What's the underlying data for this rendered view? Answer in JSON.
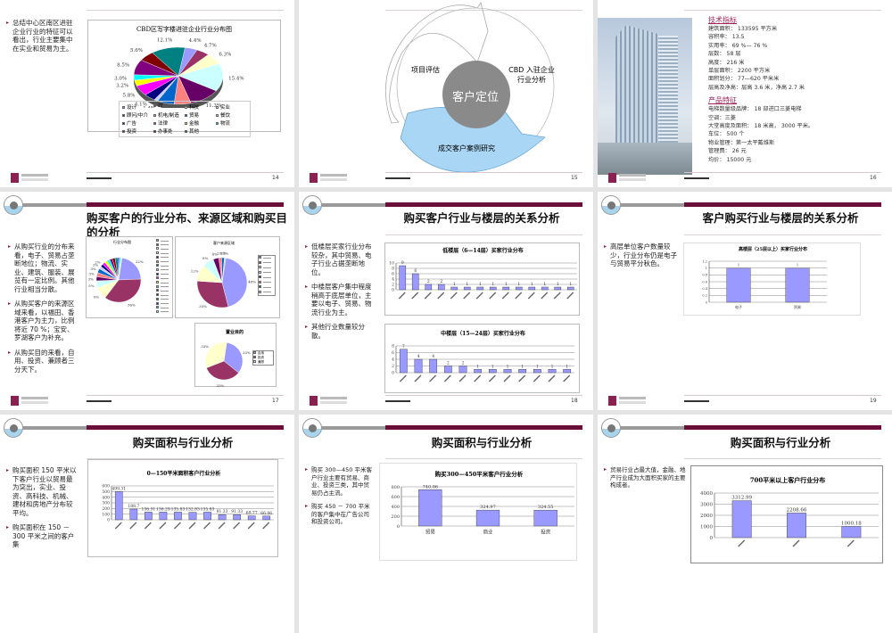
{
  "footer": {
    "pages": [
      "14",
      "15",
      "16",
      "17",
      "18",
      "19"
    ]
  },
  "s14": {
    "bullet": "总结中心区南区进驻企业行业的特征可以看出，行业主要集中在实业和贸易为主。"
  },
  "s15": {
    "center": "客户定位",
    "left": "项目评估",
    "right": "CBD 入驻企业行业分析",
    "bottom": "成交客户案例研究"
  },
  "s16": {
    "h1": "技术指标",
    "tech": [
      "建筑面积： 133595 平方米",
      "容积率： 13.5",
      "实用率： 69 %— 76 %",
      "层数： 58 层",
      "高度： 216 米",
      "单层面积： 2200 平方米",
      "面积划分： 77—620 平米米",
      "层高及净高：层高 3.6 米，净高 2.7 米"
    ],
    "h2": "产品特征",
    "prod": [
      "电梯数量级品牌： 18 部进口三菱电梯",
      "空调：三菱",
      "大堂高度及面积： 18 米高， 3000 平米。",
      "车位： 500 个",
      "物业管理：第一太平戴维斯",
      "管理费： 26 元",
      "均价： 15000 元"
    ]
  },
  "s17": {
    "title": "购买客户的行业分布、来源区域和购买目的分析",
    "bullets": [
      "从购买行业的分布来看，电子、贸易占垄断地位；物流、实业、建筑、服装、展览有一定比例。其他行业相当分散。",
      "从购买客户的来源区域来看，以福田、香港客户为主力，比例将近 70 %；宝安、罗湖客户为补充。",
      "从购买目的来看，自用、投资、兼顾者三分天下。"
    ]
  },
  "s18": {
    "title": "购买客户行业与楼层的关系分析",
    "bullets": [
      "低楼层买家行业分布较杂，其中贸易、电子行业占据垄断地位。",
      "中楼层客户集中程度稍高于底层单位，主要以电子、贸易、物流行业为主。",
      "其他行业数量较分散。"
    ]
  },
  "s19": {
    "title": "客户购买行业与楼层的关系分析",
    "bullets": [
      "高层单位客户数量较少，行业分布仍是电子与贸易平分秋色。"
    ]
  },
  "s20": {
    "title": "购买面积与行业分析",
    "bullets": [
      "购买面积 150 平米以下客户行业以贸易最为突出，实业、投资、高科技、机械、建材和房地产分布较平均。",
      "购买面积在 150 － 300 平米之间的客户集"
    ]
  },
  "s21": {
    "title": "购买面积与行业分析",
    "bullets": [
      "购买 300—450 平米客户行业主要有贸易、商业、投资三类，其中贸易仍占主流。",
      "购买 450 － 700 平米的客户集中在广告公司和投资公司。"
    ]
  },
  "s22": {
    "title": "购买面积与行业分析",
    "bullets": [
      "贸易行业占最大值，金融、地产行业成为大面积买家的主要构成者。"
    ]
  },
  "chart_data": [
    {
      "type": "pie",
      "title": "CBD区写字楼进驻企业行业分布图",
      "categories": [
        "设计",
        "IT",
        "科技",
        "实业",
        "顾问/中介",
        "机电/制造",
        "贸易",
        "餐饮",
        "广告",
        "法律",
        "金融",
        "物流",
        "投资",
        "办事处",
        "其他"
      ],
      "values": [
        4.4,
        4.7,
        6.3,
        15.4,
        11.3,
        6.0,
        6.0,
        1.4,
        4.1,
        5.8,
        3.2,
        3.0,
        8.5,
        5.6,
        12.1
      ],
      "labels": [
        "4.4%",
        "4.7%",
        "6.3%",
        "15.4%",
        "11.3%",
        "6.0%",
        "6.0%",
        "1.4%",
        "4.1%",
        "5.8%",
        "3.2%",
        "3.0%",
        "8.5%",
        "5.6%",
        "12.1%"
      ],
      "colors": [
        "#9999ff",
        "#993366",
        "#ffffcc",
        "#ccffff",
        "#660066",
        "#ff8080",
        "#0066cc",
        "#ccccff",
        "#000080",
        "#ff00ff",
        "#ffff00",
        "#00ffff",
        "#800080",
        "#800000",
        "#008080"
      ],
      "legend": "bottom"
    },
    {
      "type": "pie",
      "title": "行业分布图",
      "values": [
        22,
        36,
        9,
        5,
        3,
        3,
        3,
        2,
        2,
        2,
        2,
        2,
        2,
        2,
        2,
        1,
        1,
        1
      ],
      "labels": [
        "22%",
        "36%",
        "9%",
        "5%",
        "3%",
        "3%",
        "3%",
        "2%",
        "2%",
        "",
        "",
        "",
        "",
        "",
        "",
        "",
        "",
        ""
      ],
      "colors": [
        "#9999ff",
        "#993366",
        "#ffffcc",
        "#ccffff",
        "#660066",
        "#ff8080",
        "#0066cc",
        "#ccccff",
        "#000080",
        "#ff00ff",
        "#ffff00",
        "#00ffff",
        "#800080",
        "#800000",
        "#008080",
        "#0000ff",
        "#00ccff",
        "#ccffcc"
      ],
      "legend": "right"
    },
    {
      "type": "pie",
      "title": "客户来源区域",
      "values": [
        48,
        33,
        12,
        8,
        4,
        2,
        2,
        1
      ],
      "labels": [
        "48%",
        "33%",
        "12%",
        "8%",
        "4%",
        "2%",
        "2%",
        "1%"
      ],
      "colors": [
        "#9999ff",
        "#993366",
        "#ffffcc",
        "#ccffff",
        "#660066",
        "#ff8080",
        "#0066cc",
        "#ccccff"
      ],
      "legend": "right"
    },
    {
      "type": "pie",
      "title": "置业目的",
      "categories": [
        "自用",
        "投资",
        "兼顾"
      ],
      "values": [
        33,
        33,
        33
      ],
      "labels": [
        "33%",
        "33%",
        "33%"
      ],
      "colors": [
        "#9999ff",
        "#993366",
        "#ffffcc"
      ],
      "legend": "right"
    },
    {
      "type": "bar",
      "title": "低楼层（6—14层）买家行业分布",
      "values": [
        9,
        6,
        2,
        2,
        1,
        1,
        1,
        1,
        1,
        1,
        1,
        1,
        1,
        1
      ],
      "ylim": [
        0,
        10
      ],
      "yticks": [
        "0",
        "2",
        "4",
        "6",
        "8",
        "10"
      ],
      "color": "#9999ff"
    },
    {
      "type": "bar",
      "title": "中楼层（15—24层）买家行业分布",
      "values": [
        7,
        4,
        4,
        2,
        2,
        1,
        1,
        1,
        1,
        1,
        1,
        1
      ],
      "ylim": [
        0,
        8
      ],
      "yticks": [
        "0",
        "2",
        "4",
        "6",
        "8"
      ],
      "color": "#9999ff"
    },
    {
      "type": "bar",
      "title": "高楼层（25层以上）买家行业分布",
      "categories": [
        "电子",
        "贸易"
      ],
      "values": [
        1,
        1
      ],
      "ylim": [
        0,
        1.2
      ],
      "yticks": [
        "0",
        "0.2",
        "0.4",
        "0.6",
        "0.8",
        "1",
        "1.2"
      ],
      "color": "#9999ff"
    },
    {
      "type": "bar",
      "title": "0—150平米面积客户行业分析",
      "values": [
        499.31,
        188.7,
        136.31,
        136.29,
        135.83,
        132.83,
        135.83,
        91.33,
        91.33,
        69.77,
        66.06
      ],
      "labels": [
        "499.31",
        "188.7",
        "136.31",
        "136.29",
        "135.83",
        "132.83",
        "135.83",
        "91.33",
        "91.33",
        "69.77",
        "66.06"
      ],
      "ylim": [
        0,
        600
      ],
      "yticks": [
        "0",
        "100",
        "200",
        "300",
        "400",
        "500",
        "600"
      ],
      "color": "#9999ff"
    },
    {
      "type": "bar",
      "title": "购买300—450平米客户行业分析",
      "categories": [
        "贸易",
        "商业",
        "投资"
      ],
      "values": [
        740.86,
        324.97,
        324.55
      ],
      "labels": [
        "740.86",
        "324.97",
        "324.55"
      ],
      "ylim": [
        0,
        800
      ],
      "yticks": [
        "0",
        "200",
        "400",
        "600",
        "800"
      ],
      "color": "#9999ff"
    },
    {
      "type": "bar",
      "title": "700平米以上客户行业分布",
      "values": [
        3312.99,
        2208.66,
        1000.18
      ],
      "labels": [
        "3312.99",
        "2208.66",
        "1000.18"
      ],
      "ylim": [
        0,
        4000
      ],
      "yticks": [
        "0",
        "1000",
        "2000",
        "3000",
        "4000"
      ],
      "color": "#9999ff"
    }
  ]
}
